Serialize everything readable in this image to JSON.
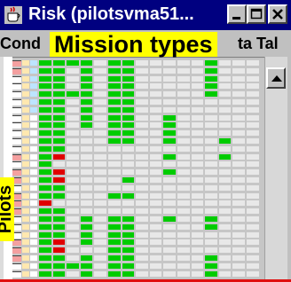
{
  "window": {
    "title": "Risk (pilotsvma51...",
    "app_icon": "java-coffee-cup-icon",
    "buttons": [
      "minimize-icon",
      "maximize-icon",
      "close-icon"
    ]
  },
  "header": {
    "col_left": "Cond",
    "col_right": "ta Tal"
  },
  "annotations": {
    "top": "Mission types",
    "side": "Pilots"
  },
  "colors": {
    "title_bar": "#000080",
    "accent_green": "#00cc00",
    "cell_empty": "#e8e8e8",
    "highlight_red": "#e00000",
    "annotation_yellow": "#ffff00"
  },
  "matrix": {
    "rows": 28,
    "cols": 16,
    "left_colors": [
      [
        "#f4a0a0",
        "#ffe8b0",
        "#bde4ff"
      ],
      [
        "#f4a0a0",
        "#ffe8b0",
        "#bde4ff"
      ],
      [
        "#ffffff",
        "#ffe8b0",
        "#bde4ff"
      ],
      [
        "#ffffff",
        "#ffe8b0",
        "#bde4ff"
      ],
      [
        "#ffffff",
        "#ffe8b0",
        "#bde4ff"
      ],
      [
        "#ffffff",
        "#ffe8b0",
        "#bde4ff"
      ],
      [
        "#ffffff",
        "#ffe8b0",
        "#bde4ff"
      ],
      [
        "#ffffff",
        "#ffe8b0",
        "#ffffff"
      ],
      [
        "#ffffff",
        "#ffe8b0",
        "#ffffff"
      ],
      [
        "#ffffff",
        "#ffe8b0",
        "#ffffff"
      ],
      [
        "#ffffff",
        "#ffe8b0",
        "#ffffff"
      ],
      [
        "#ffffff",
        "#ffe8b0",
        "#ffffff"
      ],
      [
        "#f4a0a0",
        "#ffe8b0",
        "#ffffff"
      ],
      [
        "#ffffff",
        "#ffe8b0",
        "#ffffff"
      ],
      [
        "#f4a0a0",
        "#ffe8b0",
        "#ffffff"
      ],
      [
        "#f4a0a0",
        "#ffe8b0",
        "#ffffff"
      ],
      [
        "#ffffff",
        "#ffe8b0",
        "#ffffff"
      ],
      [
        "#f4a0a0",
        "#ffe8b0",
        "#ffffff"
      ],
      [
        "#f4a0a0",
        "#ffe8b0",
        "#ffffff"
      ],
      [
        "#f4a0a0",
        "#ffe8b0",
        "#ffffff"
      ],
      [
        "#ffffff",
        "#ffe8b0",
        "#ffffff"
      ],
      [
        "#ffffff",
        "#ffe8b0",
        "#ffffff"
      ],
      [
        "#ffffff",
        "#ffe8b0",
        "#ffffff"
      ],
      [
        "#f4a0a0",
        "#ffe8b0",
        "#ffffff"
      ],
      [
        "#f4a0a0",
        "#ffe8b0",
        "#ffffff"
      ],
      [
        "#f4a0a0",
        "#ffe8b0",
        "#ffffff"
      ],
      [
        "#ffffff",
        "#ffe8b0",
        "#ffffff"
      ],
      [
        "#ffffff",
        "#ffe8b0",
        "#ffffff"
      ]
    ],
    "grid": [
      "GGGG.GG.....G...",
      "GG.G.GG.....G...",
      "GG.G.GG.....G...",
      "GG.G.GG.....G...",
      "GGGG.GG.....G...",
      "GG.G.GG.........",
      "GG.G.GG.........",
      "GG.G.GG..G......",
      "GG.G.GG..G......",
      "GG...GG..G......",
      "GG...GG..G...G..",
      "GG..............",
      "GR.......G...G..",
      "G...............",
      "GR.......G......",
      "GR....G.........",
      "GG..............",
      "GG...GG.........",
      "R...............",
      "GG..............",
      "GG.G.GG..G..G...",
      "GG.G.GG.....G...",
      "GG.G.GG.........",
      "GR.G.GG.........",
      "GR...GG.........",
      "GG.G.GG.....G...",
      "GGGG.GG.....G...",
      "GG.G.GG.....G..."
    ]
  }
}
